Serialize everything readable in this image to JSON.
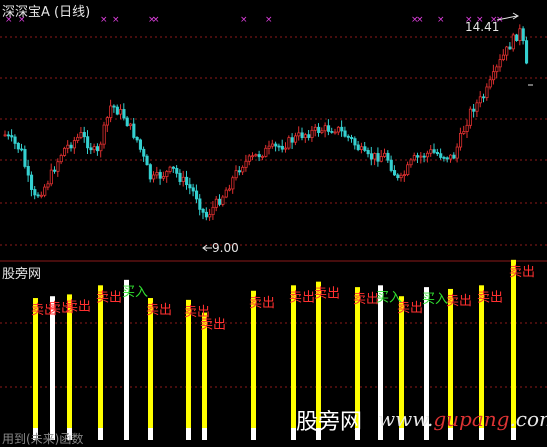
{
  "header": {
    "title": "深深宝A (日线)"
  },
  "indicator": {
    "title": "股旁网"
  },
  "price": {
    "high_label": "14.41",
    "low_label": "9.00"
  },
  "signals": {
    "sell_label": "卖出",
    "buy_label": "买入"
  },
  "watermark": {
    "left_text": "用到(未来)函数",
    "cn": "股旁网",
    "url_a": "www.",
    "url_b": "gupang",
    "url_c": ".com"
  },
  "colors": {
    "background": "#000000",
    "candle_up": "#e03030",
    "candle_down": "#35d0d0",
    "bar_yellow": "#ffff00",
    "bar_white": "#ffffff",
    "sell_text": "#ff3030",
    "buy_text": "#30e030",
    "marker": "#e040e0",
    "grid": "#8b1a1a"
  },
  "icons": {
    "marker": "x-marker-icon",
    "arrow": "arrow-left-icon"
  },
  "chart_data": [
    {
      "type": "candlestick",
      "title": "深深宝A (日线)",
      "y_range": [
        9.0,
        14.41
      ],
      "annotations": [
        {
          "label": "14.41",
          "kind": "high"
        },
        {
          "label": "9.00",
          "kind": "low"
        }
      ]
    },
    {
      "type": "bar",
      "title": "股旁网",
      "signal_bars": [
        {
          "color": "yellow",
          "level": 0.78,
          "label": "卖出"
        },
        {
          "color": "white",
          "level": 0.79,
          "label": "卖出"
        },
        {
          "color": "yellow",
          "level": 0.8,
          "label": "卖出"
        },
        {
          "color": "yellow",
          "level": 0.85,
          "label": "卖出"
        },
        {
          "color": "white",
          "level": 0.88,
          "label": "买入"
        },
        {
          "color": "yellow",
          "level": 0.78,
          "label": "卖出"
        },
        {
          "color": "yellow",
          "level": 0.77,
          "label": "卖出"
        },
        {
          "color": "yellow",
          "level": 0.7,
          "label": "卖出"
        },
        {
          "color": "yellow",
          "level": 0.82,
          "label": "卖出"
        },
        {
          "color": "yellow",
          "level": 0.85,
          "label": "卖出"
        },
        {
          "color": "yellow",
          "level": 0.87,
          "label": "卖出"
        },
        {
          "color": "yellow",
          "level": 0.84,
          "label": "卖出"
        },
        {
          "color": "white",
          "level": 0.85,
          "label": "买入"
        },
        {
          "color": "yellow",
          "level": 0.79,
          "label": "卖出"
        },
        {
          "color": "white",
          "level": 0.84,
          "label": "买入"
        },
        {
          "color": "yellow",
          "level": 0.83,
          "label": "卖出"
        },
        {
          "color": "yellow",
          "level": 0.85,
          "label": "卖出"
        },
        {
          "color": "yellow",
          "level": 0.99,
          "label": "卖出"
        }
      ]
    }
  ]
}
